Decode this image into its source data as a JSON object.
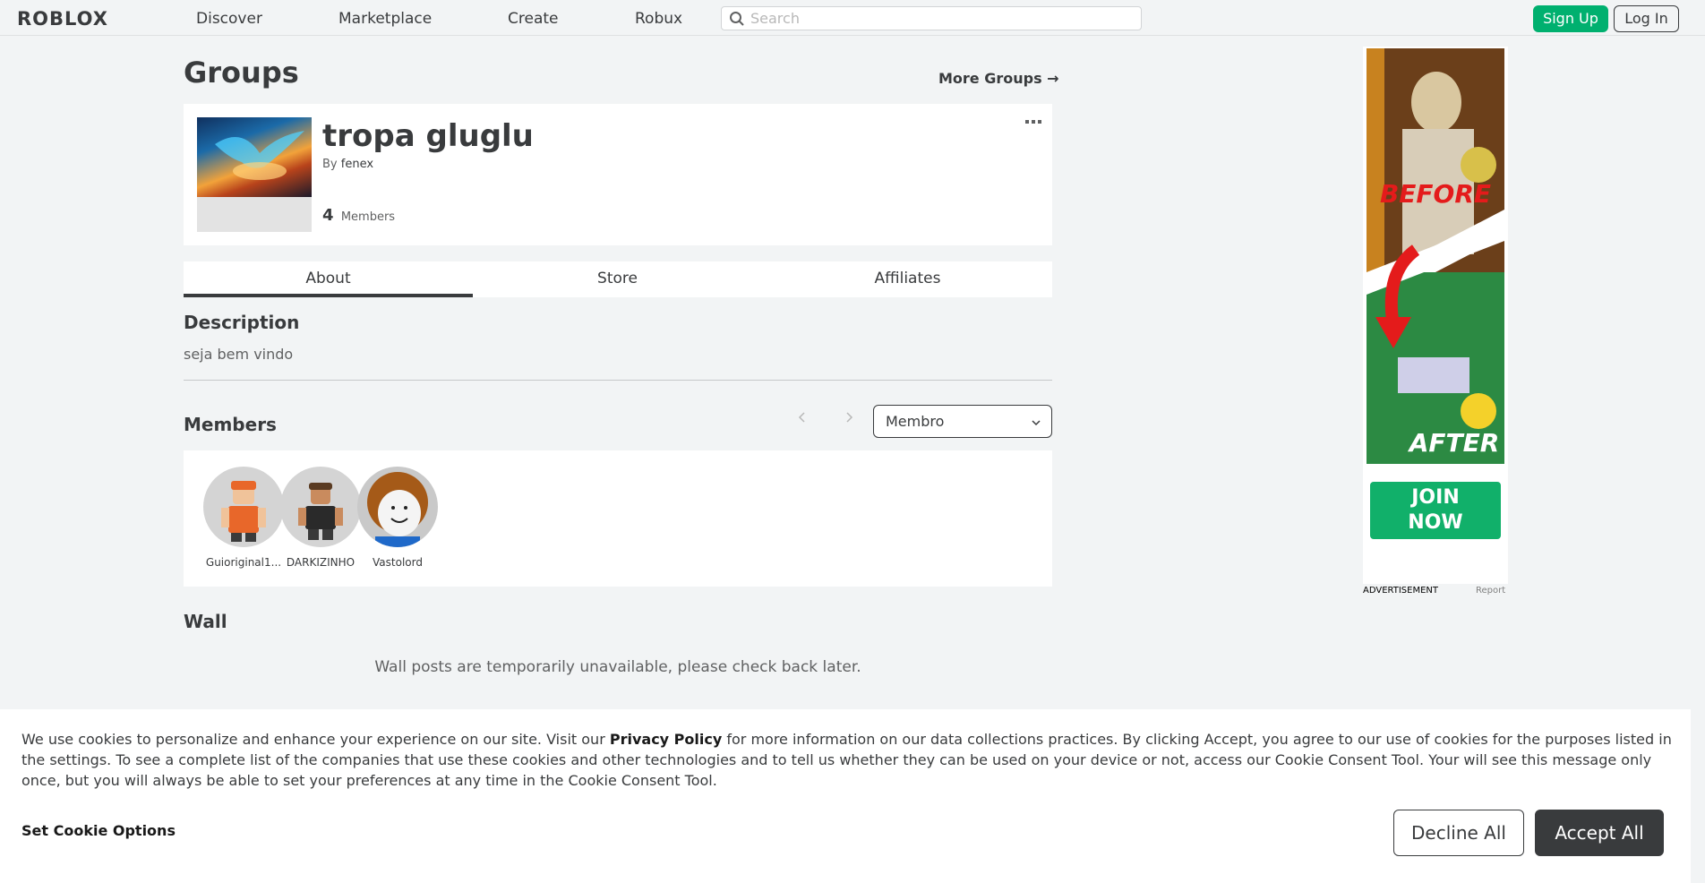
{
  "header": {
    "logo": "ROBLOX",
    "nav": [
      "Discover",
      "Marketplace",
      "Create",
      "Robux"
    ],
    "search_placeholder": "Search",
    "signup": "Sign Up",
    "login": "Log In"
  },
  "page": {
    "title": "Groups",
    "more_groups": "More Groups →"
  },
  "group": {
    "name": "tropa gluglu",
    "by_label": "By",
    "owner": "fenex",
    "member_count": "4",
    "members_label": "Members"
  },
  "tabs": [
    "About",
    "Store",
    "Affiliates"
  ],
  "description": {
    "heading": "Description",
    "text": "seja bem vindo"
  },
  "members": {
    "heading": "Members",
    "role": "Membro",
    "list": [
      {
        "name": "Guioriginal1..."
      },
      {
        "name": "DARKIZINHO"
      },
      {
        "name": "Vastolord"
      }
    ]
  },
  "wall": {
    "heading": "Wall",
    "message": "Wall posts are temporarily unavailable, please check back later."
  },
  "ad": {
    "before": "BEFORE",
    "after": "AFTER",
    "join": "JOIN NOW",
    "label": "ADVERTISEMENT",
    "report": "Report"
  },
  "cookie": {
    "text_before": "We use cookies to personalize and enhance your experience on our site. Visit our ",
    "privacy": "Privacy Policy",
    "text_after": " for more information on our data collections practices. By clicking Accept, you agree to our use of cookies for the purposes listed in the settings. To see a complete list of the companies that use these cookies and other technologies and to tell us whether they can be used on your device or not, access our Cookie Consent Tool. Your will see this message only once, but you will always be able to set your preferences at any time in the Cookie Consent Tool.",
    "options": "Set Cookie Options",
    "decline": "Decline All",
    "accept": "Accept All"
  },
  "colors": {
    "accent_green": "#00b06f",
    "text": "#393b3d",
    "background": "#f2f4f5"
  }
}
